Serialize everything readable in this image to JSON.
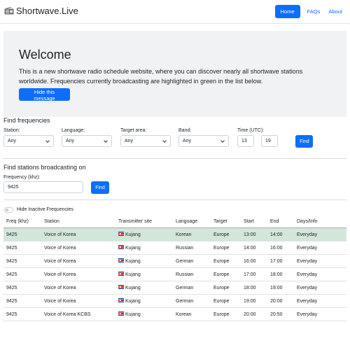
{
  "navbar": {
    "brand": "Shortwave.Live",
    "brand_icon": "radio-icon",
    "links": [
      {
        "label": "Home",
        "active": true
      },
      {
        "label": "FAQs",
        "active": false
      },
      {
        "label": "About",
        "active": false
      }
    ]
  },
  "welcome": {
    "title": "Welcome",
    "text": "This is a new shortwave radio schedule website, where you can discover nearly all shortwave stations worldwide. Frequencies currently broadcasting are highlighted in green in the list below.",
    "hide_button": "Hide this message"
  },
  "find_frequencies": {
    "title": "Find frequencies",
    "station_label": "Station:",
    "station_value": "Any",
    "language_label": "Language:",
    "language_value": "Any",
    "target_label": "Target area:",
    "target_value": "Any",
    "band_label": "Band:",
    "band_value": "Any",
    "time_label": "Time (UTC):",
    "time_hour": "13",
    "time_minute": "19",
    "find_button": "Find"
  },
  "find_stations": {
    "title": "Find stations broadcasting on",
    "frequency_label": "Frequency (khz):",
    "frequency_value": "9425",
    "find_button": "Find"
  },
  "filter": {
    "hide_inactive_label": "Hide Inactive Frequencies",
    "hide_inactive_on": false
  },
  "table": {
    "headers": [
      "Freq (khz)",
      "Station",
      "Transmitter site",
      "Language",
      "Target",
      "Start",
      "End",
      "Days/Info"
    ],
    "rows": [
      {
        "freq": "9425",
        "station": "Voice of Korea",
        "site": "Kujang",
        "language": "Korean",
        "target": "Europe",
        "start": "13:00",
        "end": "14:00",
        "days": "Everyday",
        "active": true
      },
      {
        "freq": "9425",
        "station": "Voice of Korea",
        "site": "Kujang",
        "language": "Russian",
        "target": "Europe",
        "start": "14:00",
        "end": "16:00",
        "days": "Everyday",
        "active": false
      },
      {
        "freq": "9425",
        "station": "Voice of Korea",
        "site": "Kujang",
        "language": "German",
        "target": "Europe",
        "start": "16:00",
        "end": "17:00",
        "days": "Everyday",
        "active": false
      },
      {
        "freq": "9425",
        "station": "Voice of Korea",
        "site": "Kujang",
        "language": "Russian",
        "target": "Europe",
        "start": "17:00",
        "end": "18:00",
        "days": "Everyday",
        "active": false
      },
      {
        "freq": "9425",
        "station": "Voice of Korea",
        "site": "Kujang",
        "language": "German",
        "target": "Europe",
        "start": "18:00",
        "end": "19:00",
        "days": "Everyday",
        "active": false
      },
      {
        "freq": "9425",
        "station": "Voice of Korea",
        "site": "Kujang",
        "language": "German",
        "target": "Europe",
        "start": "19:00",
        "end": "20:00",
        "days": "Everyday",
        "active": false
      },
      {
        "freq": "9425",
        "station": "Voice of Korea KCBS",
        "site": "Kujang",
        "language": "Korean",
        "target": "Europe",
        "start": "20:00",
        "end": "20:50",
        "days": "Everyday",
        "active": false
      }
    ],
    "flag_icon": "north-korea-flag-icon"
  },
  "colors": {
    "primary": "#0d6efd",
    "active_row": "#d3e6da",
    "welcome_bg": "#f1f2f4"
  }
}
